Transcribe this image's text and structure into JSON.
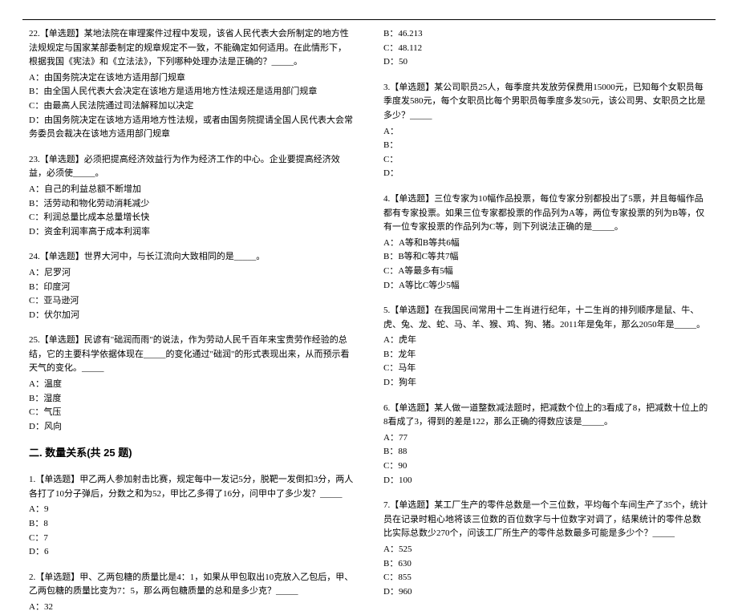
{
  "left": {
    "q22": {
      "text": "22.【单选题】某地法院在审理案件过程中发现，该省人民代表大会所制定的地方性法规规定与国家某部委制定的规章规定不一致，不能确定如何适用。在此情形下，根据我国《宪法》和《立法法》，下列哪种处理办法是正确的？_____。",
      "a": "A：由国务院决定在该地方适用部门规章",
      "b": "B：由全国人民代表大会决定在该地方是适用地方性法规还是适用部门规章",
      "c": "C：由最高人民法院通过司法解释加以决定",
      "d": "D：由国务院决定在该地方适用地方性法规，或者由国务院提请全国人民代表大会常务委员会裁决在该地方适用部门规章"
    },
    "q23": {
      "text": "23.【单选题】必须把提高经济效益行为作为经济工作的中心。企业要提高经济效益，必须使_____。",
      "a": "A：自己的利益总额不断增加",
      "b": "B：活劳动和物化劳动消耗减少",
      "c": "C：利润总量比成本总量增长快",
      "d": "D：资金利润率高于成本利润率"
    },
    "q24": {
      "text": "24.【单选题】世界大河中，与长江流向大致相同的是_____。",
      "a": "A：尼罗河",
      "b": "B：印度河",
      "c": "C：亚马逊河",
      "d": "D：伏尔加河"
    },
    "q25": {
      "text": "25.【单选题】民谚有\"础润而雨\"的说法，作为劳动人民千百年来宝贵劳作经验的总结，它的主要科学依据体现在_____的变化通过\"础润\"的形式表现出来，从而预示看天气的变化。_____",
      "a": "A：温度",
      "b": "B：湿度",
      "c": "C：气压",
      "d": "D：风向"
    },
    "section2": "二. 数量关系(共 25 题)",
    "q2_1": {
      "text": "1.【单选题】甲乙两人参加射击比赛，规定每中一发记5分，脱靶一发倒扣3分，两人各打了10分子弹后，分数之和为52，甲比乙多得了16分，问甲中了多少发？_____",
      "a": "A：9",
      "b": "B：8",
      "c": "C：7",
      "d": "D：6"
    },
    "q2_2": {
      "text": "2.【单选题】甲、乙两包糖的质量比是4：1，如果从甲包取出10克放入乙包后，甲、乙两包糖的质量比变为7：5，那么两包糖质量的总和是多少克？_____",
      "a": "A：32"
    }
  },
  "right": {
    "q2_2_cont": {
      "b": "B：46.213",
      "c": "C：48.112",
      "d": "D：50"
    },
    "q2_3": {
      "text": "3.【单选题】某公司职员25人，每季度共发放劳保费用15000元，已知每个女职员每季度发580元，每个女职员比每个男职员每季度多发50元，该公司男、女职员之比是多少？_____",
      "a": "A：",
      "b": "B：",
      "c": "C：",
      "d": "D："
    },
    "q2_4": {
      "text": "4.【单选题】三位专家为10幅作品投票，每位专家分别都投出了5票，并且每幅作品都有专家投票。如果三位专家都投票的作品列为A等，两位专家投票的列为B等，仅有一位专家投票的作品列为C等，则下列说法正确的是_____。",
      "a": "A：A等和B等共6幅",
      "b": "B：B等和C等共7幅",
      "c": "C：A等最多有5幅",
      "d": "D：A等比C等少5幅"
    },
    "q2_5": {
      "text": "5.【单选题】在我国民间常用十二生肖进行纪年，十二生肖的排列顺序是鼠、牛、虎、兔、龙、蛇、马、羊、猴、鸡、狗、猪。2011年是兔年，那么2050年是_____。",
      "a": "A：虎年",
      "b": "B：龙年",
      "c": "C：马年",
      "d": "D：狗年"
    },
    "q2_6": {
      "text": "6.【单选题】某人做一道整数减法题时，把减数个位上的3看成了8，把减数十位上的8看成了3，得到的差是122，那么正确的得数应该是_____。",
      "a": "A：77",
      "b": "B：88",
      "c": "C：90",
      "d": "D：100"
    },
    "q2_7": {
      "text": "7.【单选题】某工厂生产的零件总数是一个三位数，平均每个车间生产了35个，统计员在记录时粗心地将该三位数的百位数字与十位数字对调了，结果统计的零件总数比实际总数少270个，问该工厂所生产的零件总数最多可能是多少个？_____",
      "a": "A：525",
      "b": "B：630",
      "c": "C：855",
      "d": "D：960"
    }
  }
}
